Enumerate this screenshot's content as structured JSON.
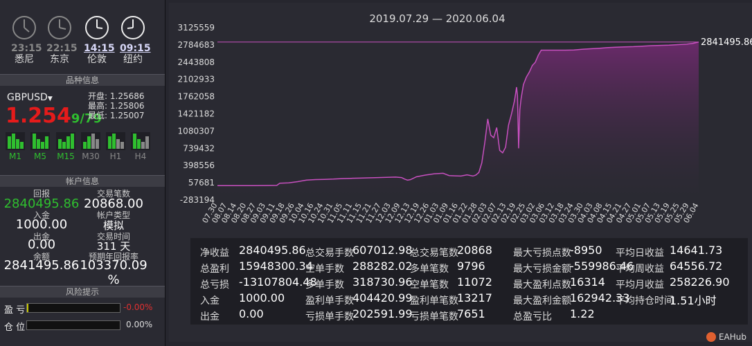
{
  "clocks": [
    {
      "time": "23:15",
      "city": "悉尼",
      "active": false
    },
    {
      "time": "22:15",
      "city": "东京",
      "active": false
    },
    {
      "time": "14:15",
      "city": "伦敦",
      "active": true
    },
    {
      "time": "09:15",
      "city": "纽约",
      "active": true
    }
  ],
  "sections": {
    "instrument": "品种信息",
    "account": "帐户信息",
    "risk": "风险提示"
  },
  "instrument": {
    "symbol": "GBPUSD",
    "price": "1.254",
    "price_sub": "9/79",
    "open_label": "开盘:",
    "open": "1.25686",
    "high_label": "最高:",
    "high": "1.25806",
    "low_label": "最低:",
    "low": "1.25007",
    "timeframes": [
      "M1",
      "M5",
      "M15",
      "M30",
      "H1",
      "H4"
    ]
  },
  "account": {
    "return_label": "回报",
    "return": "2840495.86",
    "trades_label": "交易笔数",
    "trades": "20868.00",
    "deposit_label": "入金",
    "deposit": "1000.00",
    "type_label": "帐户类型",
    "type": "模拟",
    "withdraw_label": "出金",
    "withdraw": "0.00",
    "time_label": "交易时间",
    "time": "311 天",
    "balance_label": "余额",
    "balance": "2841495.86",
    "annual_label": "预期年回报率",
    "annual": "103370.09 %"
  },
  "risk": {
    "profit_label": "盈 亏",
    "profit_value": "-0.00%",
    "position_label": "仓 位",
    "position_value": "0.00%"
  },
  "chart_data": {
    "type": "area",
    "title": "2019.07.29 — 2020.06.04",
    "yticks": [
      "3125559",
      "2784683",
      "2443808",
      "2102933",
      "1762058",
      "1421182",
      "1080307",
      "739432",
      "398556",
      "57681",
      "-283194"
    ],
    "ylim": [
      -283194,
      3125559
    ],
    "xticks": [
      "07.30",
      "08.07",
      "08.14",
      "08.20",
      "08.27",
      "09.03",
      "09.11",
      "09.18",
      "09.26",
      "10.04",
      "10.16",
      "10.24",
      "10.31",
      "11.05",
      "11.11",
      "11.15",
      "11.21",
      "11.27",
      "12.03",
      "12.09",
      "12.13",
      "12.19",
      "12.26",
      "01.03",
      "01.09",
      "01.16",
      "01.22",
      "01.28",
      "02.03",
      "02.07",
      "02.13",
      "02.19",
      "02.25",
      "03.02",
      "03.06",
      "03.12",
      "03.18",
      "03.24",
      "03.30",
      "04.03",
      "04.08",
      "04.15",
      "04.21",
      "04.27",
      "05.01",
      "05.07",
      "05.13",
      "05.19",
      "05.25",
      "05.29",
      "06.04"
    ],
    "last_value_label": "2841495.86",
    "last_value": 2841495.86,
    "line_color": "#c850c0",
    "points": [
      [
        0,
        0
      ],
      [
        3,
        0
      ],
      [
        6,
        0
      ],
      [
        9,
        1000
      ],
      [
        12,
        2000
      ],
      [
        15,
        3000
      ],
      [
        18,
        4000
      ],
      [
        20,
        6000
      ],
      [
        21,
        50000
      ],
      [
        24,
        55000
      ],
      [
        27,
        80000
      ],
      [
        30,
        110000
      ],
      [
        33,
        120000
      ],
      [
        36,
        125000
      ],
      [
        39,
        130000
      ],
      [
        42,
        140000
      ],
      [
        45,
        145000
      ],
      [
        48,
        150000
      ],
      [
        51,
        155000
      ],
      [
        54,
        160000
      ],
      [
        57,
        165000
      ],
      [
        60,
        170000
      ],
      [
        62,
        160000
      ],
      [
        63,
        130000
      ],
      [
        64,
        110000
      ],
      [
        65,
        120000
      ],
      [
        67,
        175000
      ],
      [
        70,
        210000
      ],
      [
        73,
        235000
      ],
      [
        76,
        245000
      ],
      [
        78,
        200000
      ],
      [
        80,
        195000
      ],
      [
        82,
        190000
      ],
      [
        84,
        215000
      ],
      [
        86,
        190000
      ],
      [
        87,
        210000
      ],
      [
        88,
        260000
      ],
      [
        89,
        450000
      ],
      [
        90,
        850000
      ],
      [
        91,
        1320000
      ],
      [
        92,
        1000000
      ],
      [
        93,
        950000
      ],
      [
        94,
        1150000
      ],
      [
        95,
        700000
      ],
      [
        96,
        650000
      ],
      [
        97,
        760000
      ],
      [
        98,
        1200000
      ],
      [
        99,
        1420000
      ],
      [
        100,
        1680000
      ],
      [
        100.7,
        1950000
      ],
      [
        101,
        1780000
      ],
      [
        101.4,
        740000
      ],
      [
        101.8,
        1500000
      ],
      [
        102.2,
        1720000
      ],
      [
        103,
        2000000
      ],
      [
        104,
        2150000
      ],
      [
        105,
        2250000
      ],
      [
        106,
        2380000
      ],
      [
        107,
        2440000
      ],
      [
        108,
        2580000
      ],
      [
        109,
        2680000
      ],
      [
        111,
        2680000
      ],
      [
        114,
        2680000
      ],
      [
        117,
        2680000
      ],
      [
        120,
        2685000
      ],
      [
        123,
        2700000
      ],
      [
        126,
        2710000
      ],
      [
        129,
        2720000
      ],
      [
        131,
        2730000
      ],
      [
        134,
        2740000
      ],
      [
        137,
        2745000
      ],
      [
        140,
        2750000
      ],
      [
        143,
        2760000
      ],
      [
        146,
        2770000
      ],
      [
        149,
        2775000
      ],
      [
        152,
        2780000
      ],
      [
        155,
        2790000
      ],
      [
        158,
        2800000
      ],
      [
        160,
        2815000
      ],
      [
        162,
        2841495
      ]
    ]
  },
  "stats": [
    {
      "label": "净收益",
      "value": "2840495.86"
    },
    {
      "label": "总交易手数",
      "value": "607012.98"
    },
    {
      "label": "总交易笔数",
      "value": "20868"
    },
    {
      "label": "最大亏损点数",
      "value": "-8950"
    },
    {
      "label": "平均日收益",
      "value": "14641.73"
    },
    {
      "label": "总盈利",
      "value": "15948300.34"
    },
    {
      "label": "空单手数",
      "value": "288282.02"
    },
    {
      "label": "多单笔数",
      "value": "9796"
    },
    {
      "label": "最大亏损金额",
      "value": "-559986.46"
    },
    {
      "label": "平均周收益",
      "value": "64556.72"
    },
    {
      "label": "总亏损",
      "value": "-13107804.48"
    },
    {
      "label": "多单手数",
      "value": "318730.96"
    },
    {
      "label": "空单笔数",
      "value": "11072"
    },
    {
      "label": "最大盈利点数",
      "value": "16314"
    },
    {
      "label": "平均月收益",
      "value": "258226.90"
    },
    {
      "label": "入金",
      "value": "1000.00"
    },
    {
      "label": "盈利单手数",
      "value": "404420.99"
    },
    {
      "label": "盈利单笔数",
      "value": "13217"
    },
    {
      "label": "最大盈利金额",
      "value": "162942.33"
    },
    {
      "label": "平均持仓时间",
      "value": "1.51小时"
    },
    {
      "label": "出金",
      "value": "0.00"
    },
    {
      "label": "亏损单手数",
      "value": "202591.99"
    },
    {
      "label": "亏损单笔数",
      "value": "7651"
    },
    {
      "label": "总盈亏比",
      "value": "1.22"
    }
  ],
  "brand": "EAHub"
}
